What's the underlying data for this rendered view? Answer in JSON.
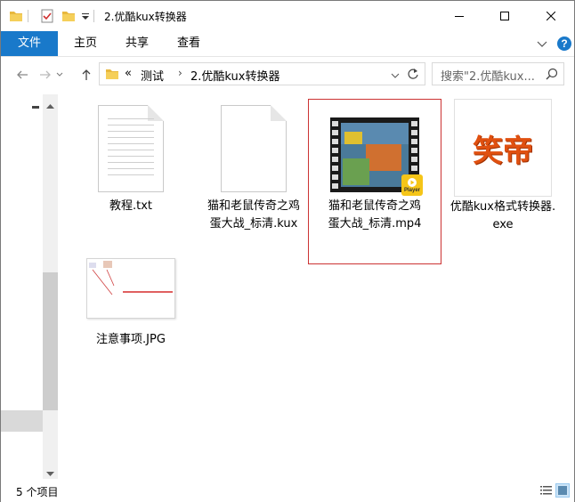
{
  "window": {
    "title": "2.优酷kux转换器"
  },
  "ribbon": {
    "tabs": [
      "文件",
      "主页",
      "共享",
      "查看"
    ]
  },
  "address": {
    "prefix": "«",
    "crumbs": [
      "测试",
      "2.优酷kux转换器"
    ]
  },
  "search": {
    "placeholder": "搜索\"2.优酷kux..."
  },
  "files": [
    {
      "name": "教程.txt",
      "type": "text"
    },
    {
      "name": "猫和老鼠传奇之鸡蛋大战_标清.kux",
      "type": "blank"
    },
    {
      "name": "猫和老鼠传奇之鸡蛋大战_标清.mp4",
      "type": "video",
      "selected": true,
      "badge": "Player"
    },
    {
      "name": "优酷kux格式转换器.exe",
      "type": "exe",
      "logo_text": "笑帝"
    },
    {
      "name": "注意事项.JPG",
      "type": "image"
    }
  ],
  "status": {
    "count": "5 个项目"
  },
  "colors": {
    "accent": "#1979ca",
    "selection_border": "#cc3333"
  }
}
